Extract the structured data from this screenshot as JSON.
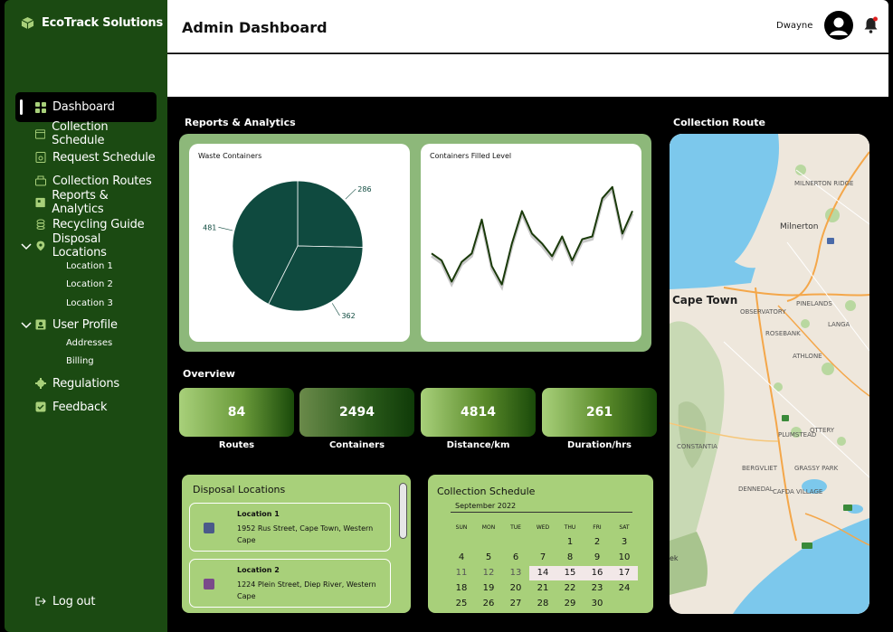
{
  "app": {
    "brand": "EcoTrack Solutions"
  },
  "header": {
    "title": "Admin Dashboard",
    "user_name": "Dwayne"
  },
  "sidebar": {
    "items": [
      {
        "label": "Dashboard",
        "icon": "grid-icon"
      },
      {
        "label": "Collection Schedule",
        "icon": "calendar-icon"
      },
      {
        "label": "Request Schedule",
        "icon": "request-icon"
      },
      {
        "label": "Collection Routes",
        "icon": "truck-icon"
      },
      {
        "label": "Reports & Analytics",
        "icon": "report-icon"
      },
      {
        "label": "Recycling Guide",
        "icon": "recycle-icon"
      },
      {
        "label": "Disposal Locations",
        "icon": "location-pin-icon"
      },
      {
        "label": "User Profile",
        "icon": "id-card-icon"
      },
      {
        "label": "Regulations",
        "icon": "gear-icon"
      },
      {
        "label": "Feedback",
        "icon": "check-icon"
      }
    ],
    "disposal_sub": [
      "Location 1",
      "Location 2",
      "Location 3"
    ],
    "profile_sub": [
      "Addresses",
      "Billing"
    ],
    "logout": "Log out"
  },
  "sections": {
    "reports": "Reports & Analytics",
    "overview": "Overview",
    "route": "Collection Route"
  },
  "charts": {
    "pie_title": "Waste Containers",
    "line_title": "Containers Filled Level"
  },
  "chart_data": [
    {
      "type": "pie",
      "title": "Waste Containers",
      "slices": [
        {
          "label": "286",
          "value": 286
        },
        {
          "label": "362",
          "value": 362
        },
        {
          "label": "481",
          "value": 481
        }
      ],
      "color": "#0f4a3f"
    },
    {
      "type": "line",
      "title": "Containers Filled Level",
      "x": [
        1,
        2,
        3,
        4,
        5,
        6,
        7,
        8,
        9,
        10,
        11,
        12,
        13,
        14,
        15,
        16,
        17,
        18,
        19,
        20
      ],
      "values": [
        38,
        33,
        18,
        32,
        38,
        62,
        29,
        16,
        45,
        68,
        52,
        45,
        36,
        50,
        33,
        48,
        50,
        77,
        85,
        52,
        68
      ],
      "color": "#1a3a0a"
    }
  ],
  "overview": [
    {
      "value": "84",
      "label": "Routes"
    },
    {
      "value": "2494",
      "label": "Containers"
    },
    {
      "value": "4814",
      "label": "Distance/km"
    },
    {
      "value": "261",
      "label": "Duration/hrs"
    }
  ],
  "disposal": {
    "title": "Disposal Locations",
    "locations": [
      {
        "name": "Location 1",
        "address": "1952 Rus Street, Cape Town, Western Cape",
        "color": "#4a5a8a"
      },
      {
        "name": "Location 2",
        "address": "1224 Plein Street, Diep River, Western Cape",
        "color": "#7a4a8a"
      }
    ]
  },
  "schedule": {
    "title": "Collection Schedule",
    "month": "September 2022",
    "weekdays": [
      "SUN",
      "MON",
      "TUE",
      "WED",
      "THU",
      "FRI",
      "SAT"
    ],
    "weeks": [
      [
        "",
        "",
        "",
        "",
        "1",
        "2",
        "3"
      ],
      [
        "4",
        "5",
        "6",
        "7",
        "8",
        "9",
        "10"
      ],
      [
        "11",
        "12",
        "13",
        "14",
        "15",
        "16",
        "17"
      ],
      [
        "18",
        "19",
        "20",
        "21",
        "22",
        "23",
        "24"
      ],
      [
        "25",
        "26",
        "27",
        "28",
        "29",
        "30",
        ""
      ]
    ],
    "highlight": [
      "14",
      "15",
      "16",
      "17"
    ]
  },
  "map": {
    "labels": [
      "MILNERTON RIDGE",
      "Milnerton",
      "Cape Town",
      "OBSERVATORY",
      "PINELANDS",
      "LANGA",
      "ROSEBANK",
      "ATHLONE",
      "OTTERY",
      "CONSTANTIA",
      "PLUMSTEAD",
      "BERGVLIET",
      "GRASSY PARK",
      "DENNEDAL",
      "CAFDA VILLAGE",
      "ek"
    ]
  }
}
